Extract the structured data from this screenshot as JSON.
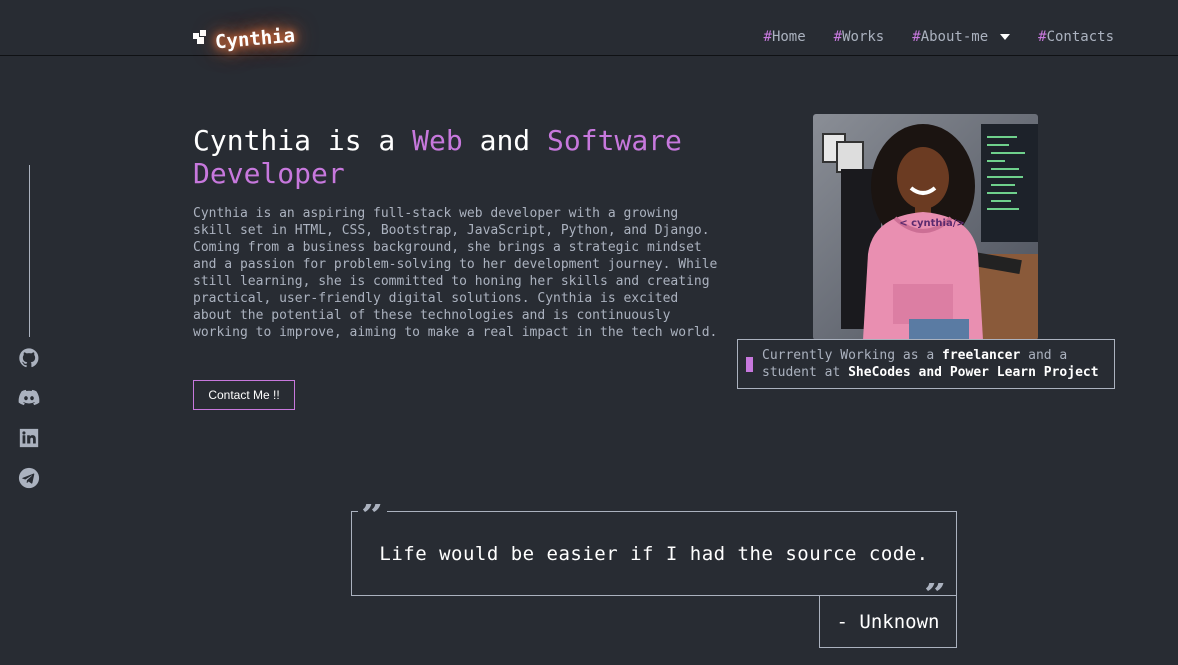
{
  "brand": {
    "name": "Cynthia"
  },
  "nav": [
    {
      "hash": "#",
      "label": "Home"
    },
    {
      "hash": "#",
      "label": "Works"
    },
    {
      "hash": "#",
      "label": "About-me",
      "dropdown": true
    },
    {
      "hash": "#",
      "label": "Contacts"
    }
  ],
  "social": [
    "github-icon",
    "discord-icon",
    "linkedin-icon",
    "telegram-icon"
  ],
  "hero": {
    "title_1": "Cynthia is a ",
    "title_web": "Web",
    "title_and": " and ",
    "title_software": "Software",
    "title_developer": "Developer",
    "description": "Cynthia is an aspiring full-stack web developer with a growing skill set in HTML, CSS, Bootstrap, JavaScript, Python, and Django. Coming from a business background, she brings a strategic mindset and a passion for problem-solving to her development journey. While still learning, she is committed to honing her skills and creating practical, user-friendly digital solutions. Cynthia is excited about the potential of these technologies and is continuously working to improve, aiming to make a real impact in the tech world.",
    "cta": "Contact Me !!",
    "portrait_shirt_text": "< cynthia/>"
  },
  "status": {
    "prefix": "Currently Working as a ",
    "role": "freelancer",
    "middle": " and a student at ",
    "org": "SheCodes and Power Learn Project"
  },
  "quote": {
    "open_mark": "”",
    "close_mark": "”",
    "text": "Life would be easier if I had the source code.",
    "author": "- Unknown"
  },
  "colors": {
    "background": "#282c33",
    "accent": "#c778dd",
    "text": "#abb2bf",
    "heading": "#ffffff"
  }
}
